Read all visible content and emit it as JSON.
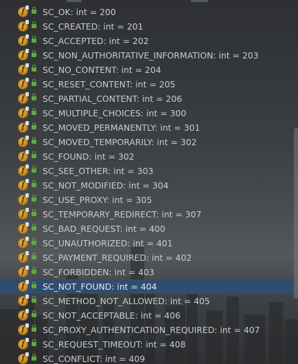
{
  "fields": [
    {
      "name": "SC_OK",
      "type": "int",
      "value": "200"
    },
    {
      "name": "SC_CREATED",
      "type": "int",
      "value": "201"
    },
    {
      "name": "SC_ACCEPTED",
      "type": "int",
      "value": "202"
    },
    {
      "name": "SC_NON_AUTHORITATIVE_INFORMATION",
      "type": "int",
      "value": "203"
    },
    {
      "name": "SC_NO_CONTENT",
      "type": "int",
      "value": "204"
    },
    {
      "name": "SC_RESET_CONTENT",
      "type": "int",
      "value": "205"
    },
    {
      "name": "SC_PARTIAL_CONTENT",
      "type": "int",
      "value": "206"
    },
    {
      "name": "SC_MULTIPLE_CHOICES",
      "type": "int",
      "value": "300"
    },
    {
      "name": "SC_MOVED_PERMANENTLY",
      "type": "int",
      "value": "301"
    },
    {
      "name": "SC_MOVED_TEMPORARILY",
      "type": "int",
      "value": "302"
    },
    {
      "name": "SC_FOUND",
      "type": "int",
      "value": "302"
    },
    {
      "name": "SC_SEE_OTHER",
      "type": "int",
      "value": "303"
    },
    {
      "name": "SC_NOT_MODIFIED",
      "type": "int",
      "value": "304"
    },
    {
      "name": "SC_USE_PROXY",
      "type": "int",
      "value": "305"
    },
    {
      "name": "SC_TEMPORARY_REDIRECT",
      "type": "int",
      "value": "307"
    },
    {
      "name": "SC_BAD_REQUEST",
      "type": "int",
      "value": "400"
    },
    {
      "name": "SC_UNAUTHORIZED",
      "type": "int",
      "value": "401"
    },
    {
      "name": "SC_PAYMENT_REQUIRED",
      "type": "int",
      "value": "402"
    },
    {
      "name": "SC_FORBIDDEN",
      "type": "int",
      "value": "403"
    },
    {
      "name": "SC_NOT_FOUND",
      "type": "int",
      "value": "404",
      "selected": true
    },
    {
      "name": "SC_METHOD_NOT_ALLOWED",
      "type": "int",
      "value": "405"
    },
    {
      "name": "SC_NOT_ACCEPTABLE",
      "type": "int",
      "value": "406"
    },
    {
      "name": "SC_PROXY_AUTHENTICATION_REQUIRED",
      "type": "int",
      "value": "407"
    },
    {
      "name": "SC_REQUEST_TIMEOUT",
      "type": "int",
      "value": "408"
    },
    {
      "name": "SC_CONFLICT",
      "type": "int",
      "value": "409"
    }
  ],
  "icons": {
    "field": "field-icon",
    "final_marker": "final-mark-icon",
    "visibility": "lock-icon"
  },
  "colors": {
    "text": "#c9ccd0",
    "selection": "#2f4d6f",
    "field_icon": "#c98f28",
    "lock_icon": "#64a742"
  }
}
